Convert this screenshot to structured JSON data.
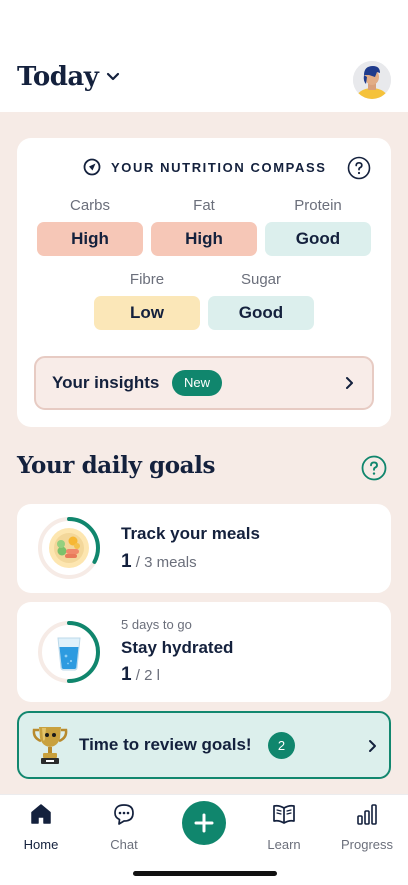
{
  "header": {
    "title": "Today"
  },
  "compass": {
    "title": "YOUR NUTRITION COMPASS",
    "items": [
      {
        "label": "Carbs",
        "value": "High",
        "level": "high"
      },
      {
        "label": "Fat",
        "value": "High",
        "level": "high"
      },
      {
        "label": "Protein",
        "value": "Good",
        "level": "good"
      },
      {
        "label": "Fibre",
        "value": "Low",
        "level": "low"
      },
      {
        "label": "Sugar",
        "value": "Good",
        "level": "good"
      }
    ],
    "insights": {
      "label": "Your insights",
      "badge": "New"
    }
  },
  "goals": {
    "title": "Your daily goals",
    "items": [
      {
        "title": "Track your meals",
        "subtitle": "",
        "current": "1",
        "target": "/ 3 meals",
        "progress": 0.33,
        "icon": "meal-plate-icon"
      },
      {
        "title": "Stay hydrated",
        "subtitle": "5 days to go",
        "current": "1",
        "target": "/ 2 l",
        "progress": 0.5,
        "icon": "water-glass-icon"
      }
    ],
    "review": {
      "label": "Time to review goals!",
      "count": "2"
    }
  },
  "tabs": [
    {
      "label": "Home",
      "icon": "home-icon",
      "active": true
    },
    {
      "label": "Chat",
      "icon": "chat-icon",
      "active": false
    },
    {
      "label": "Learn",
      "icon": "book-icon",
      "active": false
    },
    {
      "label": "Progress",
      "icon": "bar-chart-icon",
      "active": false
    }
  ],
  "colors": {
    "accent": "#10866d",
    "background": "#f6ebe6",
    "high": "#f6c7b7",
    "good": "#dcefed",
    "low": "#fbe7b8",
    "text": "#14213d"
  }
}
